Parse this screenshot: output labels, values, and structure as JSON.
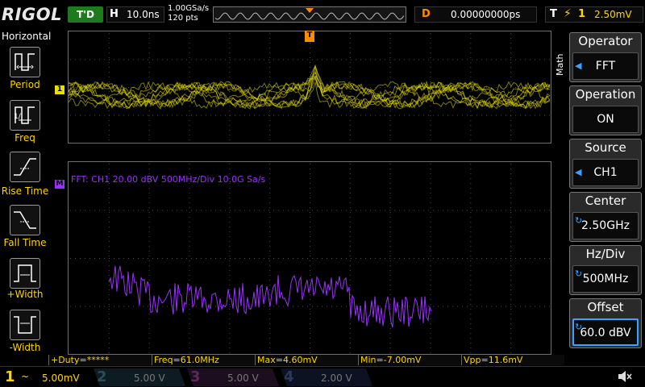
{
  "topbar": {
    "logo": "RIGOL",
    "run_status": "T'D",
    "horizontal": {
      "label": "H",
      "timebase": "10.0ns"
    },
    "sample_rate": "1.00GSa/s",
    "points": "120 pts",
    "trigger_marker": "T",
    "delay": {
      "label": "D",
      "value": "0.00000000ps"
    },
    "trigger": {
      "label": "T",
      "source": "1",
      "level": "2.50mV"
    }
  },
  "left_menu": {
    "title": "Horizontal",
    "items": [
      {
        "label": "Period",
        "icon": "period-icon"
      },
      {
        "label": "Freq",
        "icon": "frequency-icon"
      },
      {
        "label": "Rise Time",
        "icon": "rise-time-icon"
      },
      {
        "label": "Fall Time",
        "icon": "fall-time-icon"
      },
      {
        "label": "+Width",
        "icon": "positive-width-icon"
      },
      {
        "label": "-Width",
        "icon": "negative-width-icon"
      }
    ]
  },
  "right_menu": {
    "tab": "Math",
    "panels": [
      {
        "title": "Operator",
        "value": "FFT",
        "selected": false
      },
      {
        "title": "Operation",
        "value": "ON",
        "selected": false
      },
      {
        "title": "Source",
        "value": "CH1",
        "selected": false
      },
      {
        "title": "Center",
        "value": "2.50GHz",
        "selected": false
      },
      {
        "title": "Hz/Div",
        "value": "500MHz",
        "selected": false
      },
      {
        "title": "Offset",
        "value": "60.0 dBV",
        "selected": true
      }
    ]
  },
  "display": {
    "ch1_marker": "1",
    "math_marker": "M",
    "fft_label": "FFT: CH1  20.00 dBV   500MHz/Div   10.0G Sa/s",
    "ch1_color": "#e8e000",
    "math_color": "#9a30ff"
  },
  "measurements": [
    {
      "text": "+Duty=*****"
    },
    {
      "text": "Freq=61.0MHz"
    },
    {
      "text": "Max=4.60mV"
    },
    {
      "text": "Min=-7.00mV"
    },
    {
      "text": "Vpp=11.6mV"
    }
  ],
  "channels": [
    {
      "num": "1",
      "coupling": "~",
      "scale": "5.00mV",
      "color": "#ffd400",
      "active": true
    },
    {
      "num": "2",
      "coupling": "",
      "scale": "5.00 V",
      "color": "#00c0ff",
      "active": false
    },
    {
      "num": "3",
      "coupling": "",
      "scale": "5.00 V",
      "color": "#ff40ff",
      "active": false
    },
    {
      "num": "4",
      "coupling": "",
      "scale": "2.00 V",
      "color": "#3070ff",
      "active": false
    }
  ],
  "speaker_icon": "speaker-mute-icon"
}
